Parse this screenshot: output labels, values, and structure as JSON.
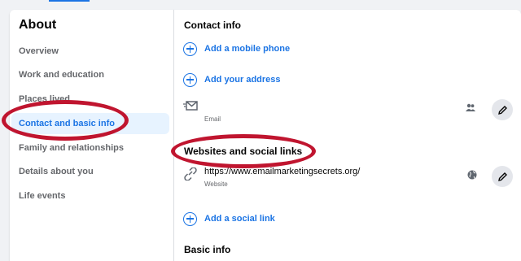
{
  "sidebar": {
    "title": "About",
    "items": [
      {
        "label": "Overview"
      },
      {
        "label": "Work and education"
      },
      {
        "label": "Places lived"
      },
      {
        "label": "Contact and basic info"
      },
      {
        "label": "Family and relationships"
      },
      {
        "label": "Details about you"
      },
      {
        "label": "Life events"
      }
    ]
  },
  "contact": {
    "title": "Contact info",
    "add_phone": "Add a mobile phone",
    "add_address": "Add your address",
    "email_label": "Email"
  },
  "websites": {
    "title": "Websites and social links",
    "url": "https://www.emailmarketingsecrets.org/",
    "url_label": "Website",
    "add_social": "Add a social link"
  },
  "basic": {
    "title": "Basic info"
  },
  "colors": {
    "accent": "#1b74e4",
    "highlight_ellipse": "#c0152f"
  }
}
